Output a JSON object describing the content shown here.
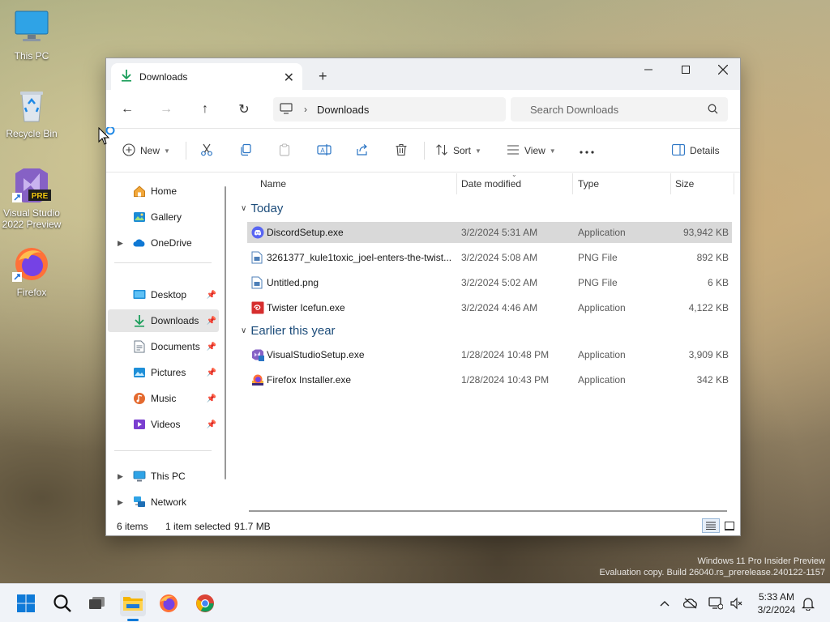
{
  "desktop": {
    "icons": [
      {
        "label": "This PC"
      },
      {
        "label": "Recycle Bin"
      },
      {
        "label": "Visual Studio 2022 Preview",
        "badge": "PRE"
      },
      {
        "label": "Firefox"
      }
    ]
  },
  "window": {
    "tab_title": "Downloads",
    "address": {
      "crumb": "Downloads"
    },
    "search": {
      "placeholder": "Search Downloads"
    },
    "toolbar": {
      "new_label": "New",
      "sort_label": "Sort",
      "view_label": "View",
      "details_label": "Details"
    },
    "nav": {
      "home": "Home",
      "gallery": "Gallery",
      "onedrive": "OneDrive",
      "desktop": "Desktop",
      "downloads": "Downloads",
      "documents": "Documents",
      "pictures": "Pictures",
      "music": "Music",
      "videos": "Videos",
      "thispc": "This PC",
      "network": "Network"
    },
    "columns": {
      "name": "Name",
      "date": "Date modified",
      "type": "Type",
      "size": "Size"
    },
    "groups": {
      "today": "Today",
      "earlier": "Earlier this year"
    },
    "files": [
      {
        "name": "DiscordSetup.exe",
        "date": "3/2/2024 5:31 AM",
        "type": "Application",
        "size": "93,942 KB",
        "icon": "discord-icon"
      },
      {
        "name": "3261377_kule1toxic_joel-enters-the-twist...",
        "date": "3/2/2024 5:08 AM",
        "type": "PNG File",
        "size": "892 KB",
        "icon": "png-file-icon"
      },
      {
        "name": "Untitled.png",
        "date": "3/2/2024 5:02 AM",
        "type": "PNG File",
        "size": "6 KB",
        "icon": "png-file-icon"
      },
      {
        "name": "Twister Icefun.exe",
        "date": "3/2/2024 4:46 AM",
        "type": "Application",
        "size": "4,122 KB",
        "icon": "twister-icon"
      },
      {
        "name": "VisualStudioSetup.exe",
        "date": "1/28/2024 10:48 PM",
        "type": "Application",
        "size": "3,909 KB",
        "icon": "visual-studio-icon"
      },
      {
        "name": "Firefox Installer.exe",
        "date": "1/28/2024 10:43 PM",
        "type": "Application",
        "size": "342 KB",
        "icon": "firefox-installer-icon"
      }
    ],
    "status": {
      "count": "6 items",
      "selection": "1 item selected",
      "size": "91.7 MB"
    }
  },
  "watermark": {
    "line1": "Windows 11 Pro Insider Preview",
    "line2": "Evaluation copy. Build 26040.rs_prerelease.240122-1157"
  },
  "taskbar": {
    "time": "5:33 AM",
    "date": "3/2/2024"
  },
  "colors": {
    "accent": "#0067c0",
    "selected_row": "#d9d9d9",
    "group_header": "#1c4c7a"
  }
}
